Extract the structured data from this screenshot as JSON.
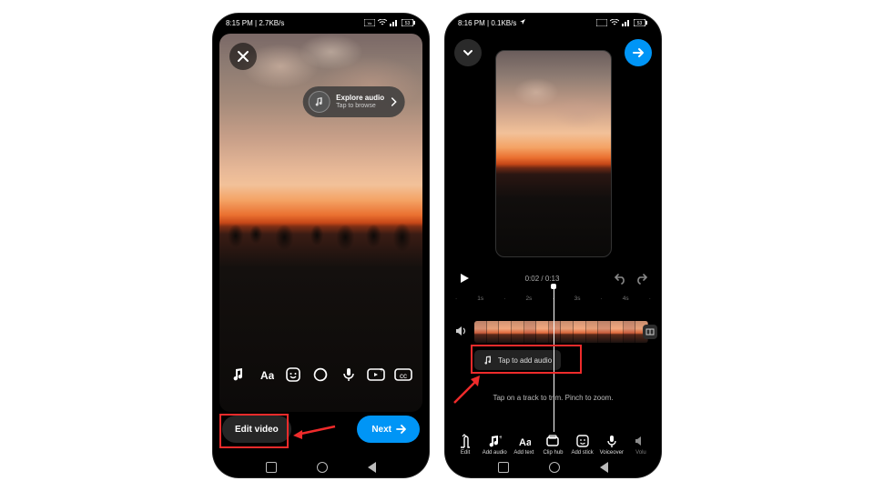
{
  "left": {
    "status": {
      "time": "8:15 PM",
      "net": "2.7KB/s"
    },
    "audio_prompt": {
      "title": "Explore audio",
      "subtitle": "Tap to browse"
    },
    "tool_icons": [
      "music-note",
      "text-aa",
      "sticker",
      "effects",
      "mic",
      "gif",
      "cc"
    ],
    "buttons": {
      "edit": "Edit video",
      "next": "Next"
    }
  },
  "right": {
    "status": {
      "time": "8:16 PM",
      "net": "0.1KB/s"
    },
    "transport": {
      "time": "0:02 / 0:13"
    },
    "ticks": [
      "",
      "1s",
      "",
      "2s",
      "",
      "3s",
      "",
      "4s",
      ""
    ],
    "audio_pill": "Tap to add audio",
    "hint": "Tap on a track to trim. Pinch to zoom.",
    "tools": [
      {
        "id": "edit",
        "label": "Edit"
      },
      {
        "id": "add-audio",
        "label": "Add audio"
      },
      {
        "id": "add-text",
        "label": "Add text"
      },
      {
        "id": "clip-hub",
        "label": "Clip hub"
      },
      {
        "id": "add-sticker",
        "label": "Add stick"
      },
      {
        "id": "voiceover",
        "label": "Voiceover"
      },
      {
        "id": "volume",
        "label": "Volu"
      }
    ]
  }
}
